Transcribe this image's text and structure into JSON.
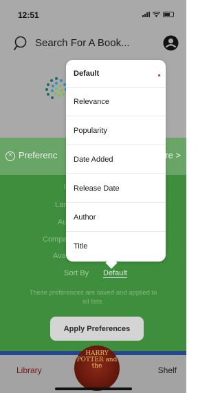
{
  "status_bar": {
    "time": "12:51"
  },
  "search": {
    "placeholder": "Search For A Book..."
  },
  "preferences": {
    "title": "Preferenc",
    "more": "re >",
    "labels": [
      "l",
      "Lar",
      "Au",
      "Compa",
      "Ava"
    ],
    "sort_by_label": "Sort By",
    "sort_by_value": "Default",
    "note": "These preferences are saved and applied to all lists.",
    "apply_button": "Apply Preferences"
  },
  "sort_menu": {
    "options": [
      "Default",
      "Relevance",
      "Popularity",
      "Date Added",
      "Release Date",
      "Author",
      "Title"
    ],
    "selected": "Default",
    "selected_marker_color": "#d0202a"
  },
  "tab_bar": {
    "library": "Library",
    "shelf": "Shelf",
    "center_book_text": "HARRY POTTER and the"
  },
  "colors": {
    "panel_green": "#3f8e3d",
    "header_green": "#69a566",
    "library_tab": "#7a1414"
  }
}
